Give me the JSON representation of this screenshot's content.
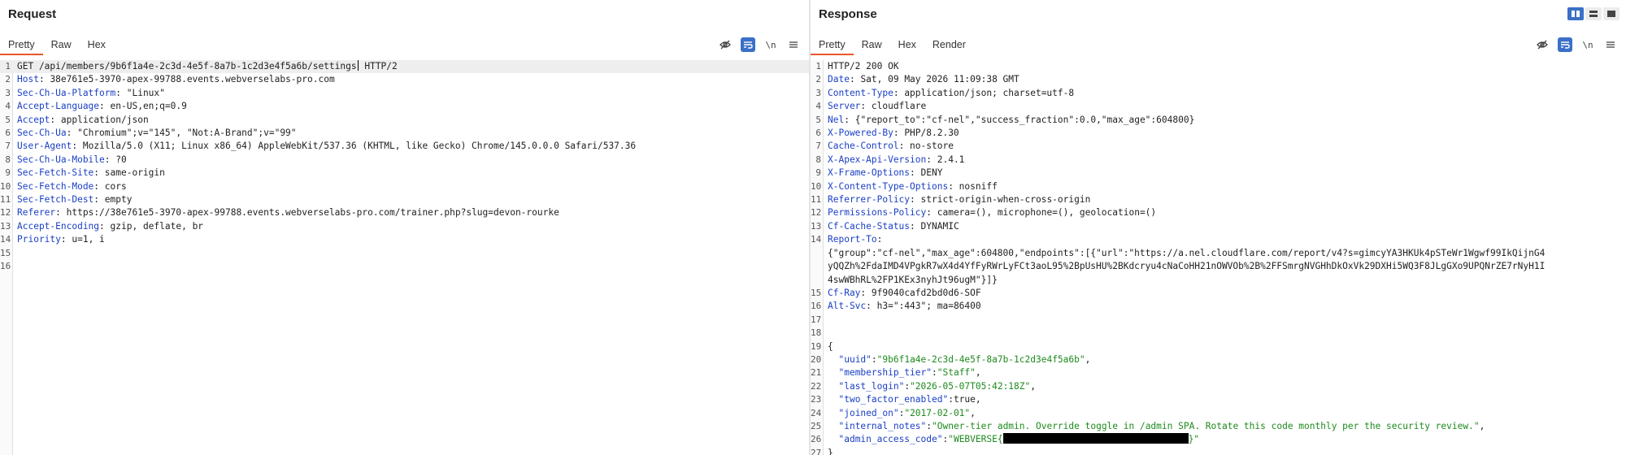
{
  "request": {
    "title": "Request",
    "tabs": [
      "Pretty",
      "Raw",
      "Hex"
    ],
    "line_numbers": [
      "1",
      "2",
      "3",
      "4",
      "5",
      "6",
      "7",
      "8",
      "9",
      "10",
      "11",
      "12",
      "13",
      "14",
      "15",
      "16"
    ],
    "request_line": {
      "before_cursor": "GET /api/members/9b6f1a4e-2c3d-4e5f-8a7b-1c2d3e4f5a6b/settings",
      "after_cursor": " HTTP/2"
    },
    "headers": [
      {
        "k": "Host",
        "v": " 38e761e5-3970-apex-99788.events.webverselabs-pro.com"
      },
      {
        "k": "Sec-Ch-Ua-Platform",
        "v": " \"Linux\""
      },
      {
        "k": "Accept-Language",
        "v": " en-US,en;q=0.9"
      },
      {
        "k": "Accept",
        "v": " application/json"
      },
      {
        "k": "Sec-Ch-Ua",
        "v": " \"Chromium\";v=\"145\", \"Not:A-Brand\";v=\"99\""
      },
      {
        "k": "User-Agent",
        "v": " Mozilla/5.0 (X11; Linux x86_64) AppleWebKit/537.36 (KHTML, like Gecko) Chrome/145.0.0.0 Safari/537.36"
      },
      {
        "k": "Sec-Ch-Ua-Mobile",
        "v": " ?0"
      },
      {
        "k": "Sec-Fetch-Site",
        "v": " same-origin"
      },
      {
        "k": "Sec-Fetch-Mode",
        "v": " cors"
      },
      {
        "k": "Sec-Fetch-Dest",
        "v": " empty"
      },
      {
        "k": "Referer",
        "v": " https://38e761e5-3970-apex-99788.events.webverselabs-pro.com/trainer.php?slug=devon-rourke"
      },
      {
        "k": "Accept-Encoding",
        "v": " gzip, deflate, br"
      },
      {
        "k": "Priority",
        "v": " u=1, i"
      }
    ]
  },
  "response": {
    "title": "Response",
    "tabs": [
      "Pretty",
      "Raw",
      "Hex",
      "Render"
    ],
    "line_numbers": [
      "1",
      "2",
      "3",
      "4",
      "5",
      "6",
      "7",
      "8",
      "9",
      "10",
      "11",
      "12",
      "13",
      "14",
      "15",
      "16",
      "17",
      "18",
      "19",
      "20",
      "21",
      "22",
      "23",
      "24",
      "25",
      "26",
      "27"
    ],
    "status_line": "HTTP/2 200 OK",
    "headers": [
      {
        "k": "Date",
        "v": " Sat, 09 May 2026 11:09:38 GMT"
      },
      {
        "k": "Content-Type",
        "v": " application/json; charset=utf-8"
      },
      {
        "k": "Server",
        "v": " cloudflare"
      },
      {
        "k": "Nel",
        "v": " {\"report_to\":\"cf-nel\",\"success_fraction\":0.0,\"max_age\":604800}"
      },
      {
        "k": "X-Powered-By",
        "v": " PHP/8.2.30"
      },
      {
        "k": "Cache-Control",
        "v": " no-store"
      },
      {
        "k": "X-Apex-Api-Version",
        "v": " 2.4.1"
      },
      {
        "k": "X-Frame-Options",
        "v": " DENY"
      },
      {
        "k": "X-Content-Type-Options",
        "v": " nosniff"
      },
      {
        "k": "Referrer-Policy",
        "v": " strict-origin-when-cross-origin"
      },
      {
        "k": "Permissions-Policy",
        "v": " camera=(), microphone=(), geolocation=()"
      },
      {
        "k": "Cf-Cache-Status",
        "v": " DYNAMIC"
      },
      {
        "k": "Report-To",
        "v": ""
      }
    ],
    "report_to_wrapped": [
      "{\"group\":\"cf-nel\",\"max_age\":604800,\"endpoints\":[{\"url\":\"https://a.nel.cloudflare.com/report/v4?s=gimcyYA3HKUk4pSTeWr1Wgwf99IkQijnG4",
      "yQQZh%2FdaIMD4VPgkR7wX4d4YfFyRWrLyFCt3aoL95%2BpUsHU%2BKdcryu4cNaCoHH21nOWVOb%2B%2FFSmrgNVGHhDkOxVk29DXHi5WQ3F8JLgGXo9UPQNrZE7rNyH1I",
      "4swWBhRL%2FP1KEx3nyhJt96ugM\"}]}"
    ],
    "headers_after": [
      {
        "k": "Cf-Ray",
        "v": " 9f9040cafd2bd0d6-SOF"
      },
      {
        "k": "Alt-Svc",
        "v": " h3=\":443\"; ma=86400"
      }
    ],
    "json_open": "{",
    "json_close": "}",
    "body": [
      {
        "k": "\"uuid\"",
        "v": "\"9b6f1a4e-2c3d-4e5f-8a7b-1c2d3e4f5a6b\"",
        "tail": ","
      },
      {
        "k": "\"membership_tier\"",
        "v": "\"Staff\"",
        "tail": ","
      },
      {
        "k": "\"last_login\"",
        "v": "\"2026-05-07T05:42:18Z\"",
        "tail": ","
      },
      {
        "k": "\"two_factor_enabled\"",
        "v": "true",
        "tail": ","
      },
      {
        "k": "\"joined_on\"",
        "v": "\"2017-02-01\"",
        "tail": ","
      },
      {
        "k": "\"internal_notes\"",
        "v": "\"Owner-tier admin. Override toggle in /admin SPA. Rotate this code monthly per the security review.\"",
        "tail": ","
      },
      {
        "k": "\"admin_access_code\"",
        "v_prefix": "\"WEBVERSE{",
        "v_suffix": "}\"",
        "tail": ""
      }
    ]
  },
  "toolbar": {
    "newline_label": "\\n",
    "icons": [
      "eye-slash-icon",
      "wrap-lines-icon",
      "newline-icon",
      "menu-icon"
    ],
    "layout_icons": [
      "layout-split-icon",
      "layout-horizontal-icon",
      "layout-single-icon"
    ]
  }
}
